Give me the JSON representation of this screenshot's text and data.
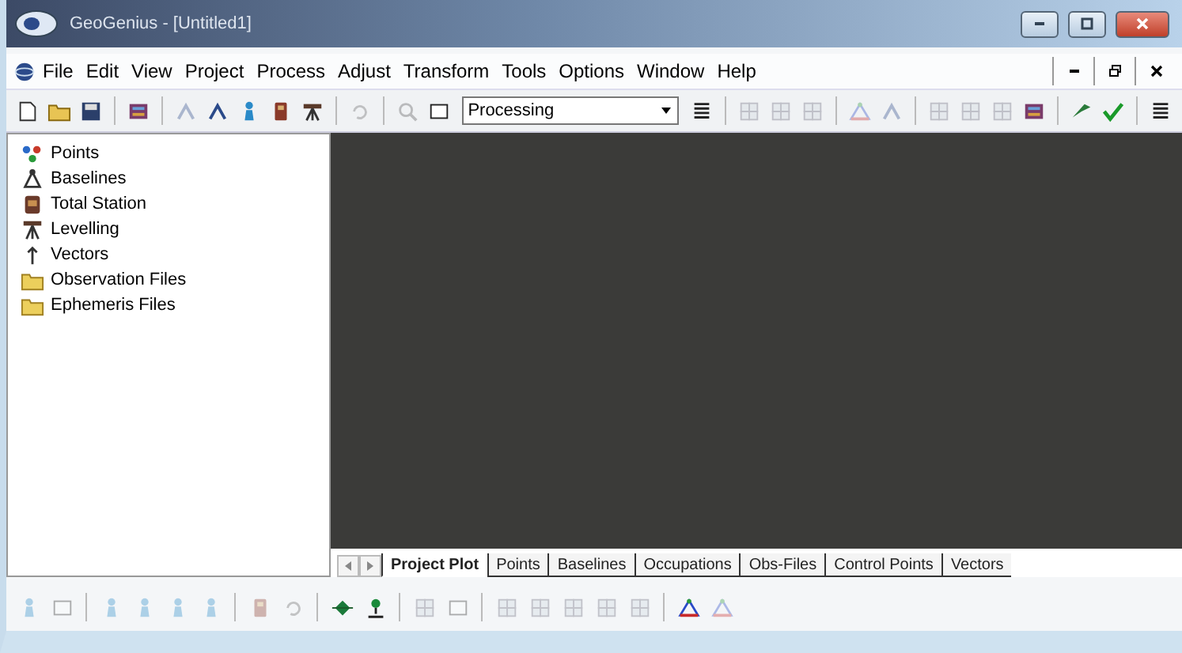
{
  "window": {
    "title": "GeoGenius - [Untitled1]"
  },
  "menu": [
    "File",
    "Edit",
    "View",
    "Project",
    "Process",
    "Adjust",
    "Transform",
    "Tools",
    "Options",
    "Window",
    "Help"
  ],
  "toolbar": [
    {
      "kind": "page",
      "disabled": false
    },
    {
      "kind": "folder",
      "disabled": false
    },
    {
      "kind": "disk",
      "disabled": false
    },
    {
      "kind": "gap"
    },
    {
      "kind": "stack",
      "disabled": false
    },
    {
      "kind": "gap"
    },
    {
      "kind": "node",
      "disabled": true
    },
    {
      "kind": "node",
      "disabled": false
    },
    {
      "kind": "person",
      "disabled": false
    },
    {
      "kind": "device",
      "disabled": false
    },
    {
      "kind": "tripod",
      "disabled": false
    },
    {
      "kind": "gap"
    },
    {
      "kind": "undo",
      "disabled": true
    },
    {
      "kind": "gap"
    },
    {
      "kind": "zoom",
      "disabled": true
    },
    {
      "kind": "frame",
      "disabled": false
    }
  ],
  "mode_select": {
    "value": "Processing"
  },
  "toolbar_right": [
    {
      "kind": "list",
      "disabled": false
    },
    {
      "kind": "gap"
    },
    {
      "kind": "grid",
      "disabled": true
    },
    {
      "kind": "grid",
      "disabled": true
    },
    {
      "kind": "grid",
      "disabled": true
    },
    {
      "kind": "gap"
    },
    {
      "kind": "triangle",
      "disabled": true
    },
    {
      "kind": "node",
      "disabled": true
    },
    {
      "kind": "gap"
    },
    {
      "kind": "grid",
      "disabled": true
    },
    {
      "kind": "grid",
      "disabled": true
    },
    {
      "kind": "grid",
      "disabled": true
    },
    {
      "kind": "stack",
      "disabled": false
    },
    {
      "kind": "gap"
    },
    {
      "kind": "flag",
      "disabled": false
    },
    {
      "kind": "check",
      "disabled": false
    },
    {
      "kind": "gap"
    },
    {
      "kind": "list",
      "disabled": false
    }
  ],
  "tree": [
    {
      "kind": "points",
      "label": "Points"
    },
    {
      "kind": "baselines",
      "label": "Baselines"
    },
    {
      "kind": "station",
      "label": "Total Station"
    },
    {
      "kind": "tripod",
      "label": "Levelling"
    },
    {
      "kind": "vectors",
      "label": "Vectors"
    },
    {
      "kind": "folder",
      "label": "Observation Files"
    },
    {
      "kind": "folder",
      "label": "Ephemeris Files"
    }
  ],
  "tabs": [
    {
      "label": "Project Plot",
      "selected": true
    },
    {
      "label": "Points",
      "selected": false
    },
    {
      "label": "Baselines",
      "selected": false
    },
    {
      "label": "Occupations",
      "selected": false
    },
    {
      "label": "Obs-Files",
      "selected": false
    },
    {
      "label": "Control Points",
      "selected": false
    },
    {
      "label": "Vectors",
      "selected": false
    }
  ],
  "bottom_toolbar": [
    {
      "kind": "person",
      "disabled": true
    },
    {
      "kind": "frame",
      "disabled": true
    },
    {
      "kind": "gap"
    },
    {
      "kind": "person",
      "disabled": true
    },
    {
      "kind": "person",
      "disabled": true
    },
    {
      "kind": "person",
      "disabled": true
    },
    {
      "kind": "person",
      "disabled": true
    },
    {
      "kind": "gap"
    },
    {
      "kind": "device",
      "disabled": true
    },
    {
      "kind": "undo",
      "disabled": true
    },
    {
      "kind": "gap"
    },
    {
      "kind": "diamond",
      "disabled": false
    },
    {
      "kind": "pin",
      "disabled": false
    },
    {
      "kind": "gap"
    },
    {
      "kind": "grid",
      "disabled": true
    },
    {
      "kind": "frame",
      "disabled": true
    },
    {
      "kind": "gap"
    },
    {
      "kind": "grid",
      "disabled": true
    },
    {
      "kind": "grid",
      "disabled": true
    },
    {
      "kind": "grid",
      "disabled": true
    },
    {
      "kind": "grid",
      "disabled": true
    },
    {
      "kind": "grid",
      "disabled": true
    },
    {
      "kind": "gap"
    },
    {
      "kind": "triangle",
      "disabled": false
    },
    {
      "kind": "triangle",
      "disabled": true
    }
  ]
}
